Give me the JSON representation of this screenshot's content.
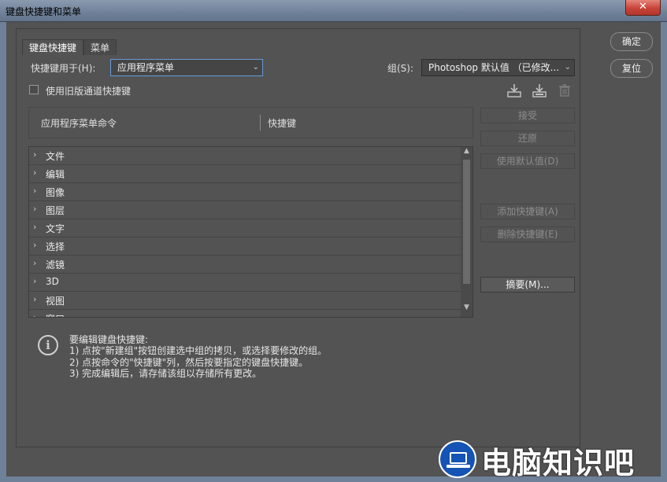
{
  "window": {
    "title": "键盘快捷键和菜单",
    "close_glyph": "✕"
  },
  "tabs": [
    {
      "label": "键盘快捷键"
    },
    {
      "label": "菜单"
    }
  ],
  "shortcut_for": {
    "label": "快捷键用于(H):",
    "value": "应用程序菜单"
  },
  "group": {
    "label": "组(S):",
    "value": "Photoshop 默认值 （已修改..."
  },
  "legacy_checkbox": {
    "label": "使用旧版通道快捷键",
    "checked": false
  },
  "toolbar_icons": [
    "save-set-icon",
    "save-set-as-icon",
    "delete-set-icon"
  ],
  "list": {
    "header_command": "应用程序菜单命令",
    "header_shortcut": "快捷键",
    "rows": [
      {
        "label": "文件"
      },
      {
        "label": "编辑"
      },
      {
        "label": "图像"
      },
      {
        "label": "图层"
      },
      {
        "label": "文字"
      },
      {
        "label": "选择"
      },
      {
        "label": "滤镜"
      },
      {
        "label": "3D"
      },
      {
        "label": "视图"
      },
      {
        "label": "窗口"
      }
    ]
  },
  "side_buttons": {
    "accept": "接受",
    "undo": "还原",
    "use_default": "使用默认值(D)",
    "add_shortcut": "添加快捷键(A)",
    "delete_shortcut": "删除快捷键(E)",
    "summarize": "摘要(M)..."
  },
  "dialog_buttons": {
    "ok": "确定",
    "reset": "复位"
  },
  "info": {
    "title": "要编辑键盘快捷键:",
    "step1": "1) 点按\"新建组\"按钮创建选中组的拷贝，或选择要修改的组。",
    "step2": "2) 点按命令的\"快捷键\"列，然后按要指定的键盘快捷键。",
    "step3": "3) 完成编辑后，请存储该组以存储所有更改。"
  },
  "watermark": {
    "text": "电脑知识吧"
  }
}
